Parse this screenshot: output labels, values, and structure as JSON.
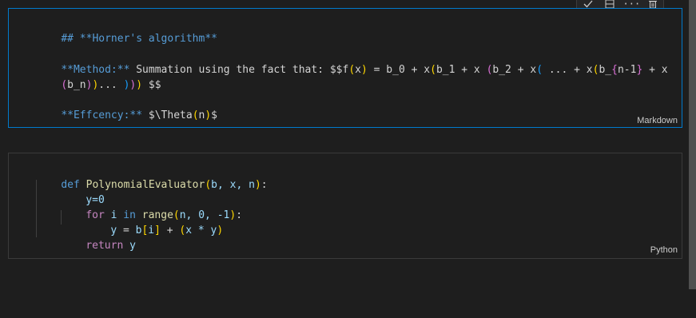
{
  "toolbar": {
    "items": [
      {
        "name": "check-icon",
        "glyph": "✓"
      },
      {
        "name": "split-cell-icon",
        "glyph": ""
      },
      {
        "name": "more-icon",
        "glyph": "···"
      },
      {
        "name": "delete-icon",
        "glyph": ""
      }
    ]
  },
  "markdown_cell": {
    "heading": "## **Horner's algorithm**",
    "method_label": "**Method:**",
    "method_text_a": " Summation using the fact that: $$f",
    "method_text_b": " = b_0 + x",
    "method_text_c": "b_1 + x ",
    "method_text_d": "b_2 + x",
    "method_text_e": " ... + x",
    "method_text_f": "b_{n-1} + x",
    "method_line2_a": "b_n",
    "method_line2_b": "... ",
    "method_line2_c": " $$",
    "efficiency_label": "**Effcency:**",
    "efficiency_text_a": " $\\Theta",
    "efficiency_text_b": "n",
    "efficiency_text_c": "$",
    "language": "Markdown"
  },
  "code_cell": {
    "lines": {
      "l1_def": "def",
      "l1_name": "PolynomialEvaluator",
      "l1_args": "b, x, n",
      "l2": "y=0",
      "l3_for": "for",
      "l3_i": "i",
      "l3_in": "in",
      "l3_range": "range",
      "l3_args": "n, 0, -1",
      "l4_y": "y",
      "l4_eq": " = ",
      "l4_b": "b",
      "l4_i": "i",
      "l4_plus": " + ",
      "l4_expr": "x * y",
      "l5_return": "return",
      "l5_y": "y"
    },
    "language": "Python"
  }
}
